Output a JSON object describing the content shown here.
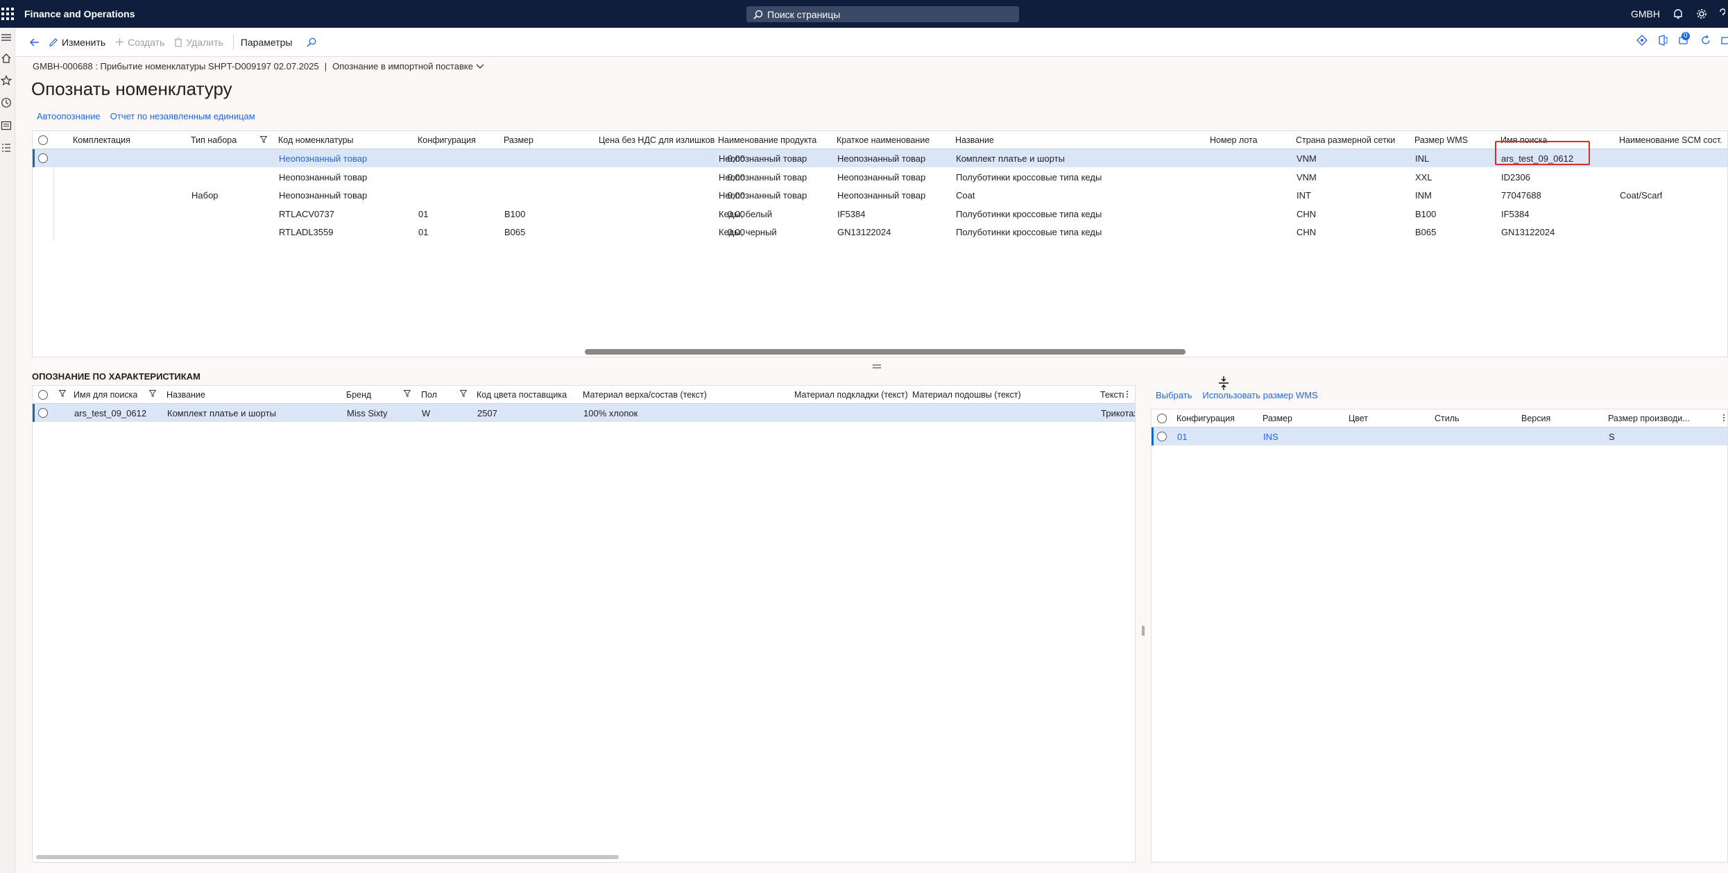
{
  "topbar": {
    "app_title": "Finance and Operations",
    "search_placeholder": "Поиск страницы",
    "company": "GMBH",
    "notification_count": "0"
  },
  "actions": {
    "edit": "Изменить",
    "create": "Создать",
    "delete": "Удалить",
    "parameters": "Параметры"
  },
  "breadcrumb": {
    "record": "GMBH-000688 : Прибытие номенклатуры SHPT-D009197 02.07.2025",
    "separator": "|",
    "view": "Опознание в импортной поставке"
  },
  "page_title": "Опознать номенклатуру",
  "links": {
    "auto": "Автоопознание",
    "report": "Отчет по незаявленным единицам"
  },
  "top_grid": {
    "columns": [
      "Комплектация",
      "Тип набора",
      "Код номенклатуры",
      "Конфигурация",
      "Размер",
      "Цена без НДС для излишков",
      "Наименование продукта",
      "Краткое наименование",
      "Название",
      "Номер лота",
      "Страна размерной сетки",
      "Размер WMS",
      "Имя поиска",
      "Наименование SCM сост."
    ],
    "rows": [
      {
        "kit": "",
        "set_type": "",
        "item_code": "Неопознанный товар",
        "config": "",
        "size": "",
        "price": "0,00",
        "product_name": "Неопознанный товар",
        "short_name": "Неопознанный товар",
        "name": "Комплект платье и шорты",
        "lot": "",
        "country": "VNM",
        "wms": "INL",
        "search": "ars_test_09_0612",
        "scm": ""
      },
      {
        "kit": "",
        "set_type": "",
        "item_code": "Неопознанный товар",
        "config": "",
        "size": "",
        "price": "0,00",
        "product_name": "Неопознанный товар",
        "short_name": "Неопознанный товар",
        "name": "Полуботинки кроссовые типа кеды",
        "lot": "",
        "country": "VNM",
        "wms": "XXL",
        "search": "ID2306",
        "scm": ""
      },
      {
        "kit": "",
        "set_type": "Набор",
        "item_code": "Неопознанный товар",
        "config": "",
        "size": "",
        "price": "0,00",
        "product_name": "Неопознанный товар",
        "short_name": "Неопознанный товар",
        "name": "Coat",
        "lot": "",
        "country": "INT",
        "wms": "INM",
        "search": "77047688",
        "scm": "Coat/Scarf"
      },
      {
        "kit": "",
        "set_type": "",
        "item_code": "RTLACV0737",
        "config": "01",
        "size": "B100",
        "price": "0,00",
        "product_name": "Кеды, белый",
        "short_name": "IF5384",
        "name": "Полуботинки кроссовые типа кеды",
        "lot": "",
        "country": "CHN",
        "wms": "B100",
        "search": "IF5384",
        "scm": ""
      },
      {
        "kit": "",
        "set_type": "",
        "item_code": "RTLADL3559",
        "config": "01",
        "size": "B065",
        "price": "0,00",
        "product_name": "Кеды, черный",
        "short_name": "GN13122024",
        "name": "Полуботинки кроссовые типа кеды",
        "lot": "",
        "country": "CHN",
        "wms": "B065",
        "search": "GN13122024",
        "scm": ""
      }
    ]
  },
  "char_section_title": "ОПОЗНАНИЕ ПО ХАРАКТЕРИСТИКАМ",
  "char_grid": {
    "columns": [
      "Имя для поиска",
      "Название",
      "Бренд",
      "Пол",
      "Код цвета поставщика",
      "Материал верха/состав (текст)",
      "Материал подкладки (текст)",
      "Материал подошвы (текст)",
      "Тексти"
    ],
    "rows": [
      {
        "search": "ars_test_09_0612",
        "name": "Комплект платье и шорты",
        "brand": "Miss Sixty",
        "gender": "W",
        "color": "2507",
        "upper": "100% хлопок",
        "lining": "",
        "sole": "",
        "textile": "Трикотаж"
      }
    ]
  },
  "right_panel": {
    "select": "Выбрать",
    "use_wms": "Использовать размер WMS",
    "columns": [
      "Конфигурация",
      "Размер",
      "Цвет",
      "Стиль",
      "Версия",
      "Размер производи..."
    ],
    "rows": [
      {
        "config": "01",
        "size": "INS",
        "color": "",
        "style": "",
        "version": "",
        "mfr_size": "S"
      }
    ]
  },
  "colors": {
    "topbar": "#0d1f3c",
    "accent": "#2266e3",
    "selected_row": "#dbe6f9",
    "highlight": "#d32f2f"
  }
}
